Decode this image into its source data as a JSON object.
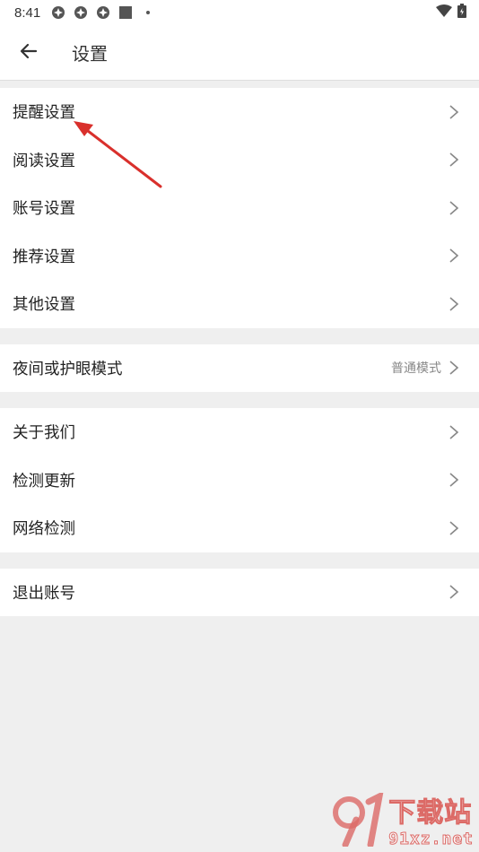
{
  "statusbar": {
    "time": "8:41"
  },
  "header": {
    "title": "设置"
  },
  "groups": [
    {
      "items": [
        {
          "label": "提醒设置"
        },
        {
          "label": "阅读设置"
        },
        {
          "label": "账号设置"
        },
        {
          "label": "推荐设置"
        },
        {
          "label": "其他设置"
        }
      ]
    },
    {
      "items": [
        {
          "label": "夜间或护眼模式",
          "value": "普通模式"
        }
      ]
    },
    {
      "items": [
        {
          "label": "关于我们"
        },
        {
          "label": "检测更新"
        },
        {
          "label": "网络检测"
        }
      ]
    },
    {
      "items": [
        {
          "label": "退出账号"
        }
      ]
    }
  ],
  "watermark": {
    "cn": "下载站",
    "en": "91xz.net"
  },
  "colors": {
    "annotation_arrow": "#d9302c",
    "watermark": "#d9534f",
    "background": "#efefef"
  }
}
